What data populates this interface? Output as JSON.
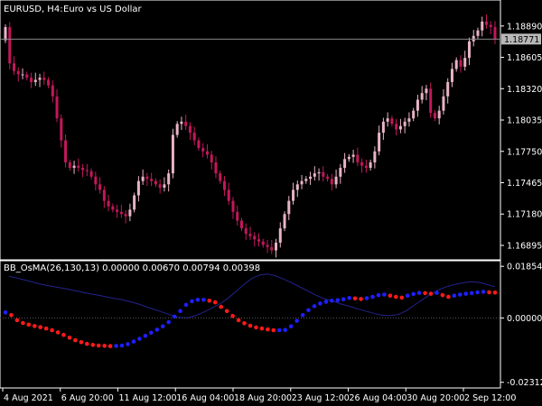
{
  "chart_header": {
    "symbol": "EURUSD, H4:",
    "description": "Euro vs US Dollar"
  },
  "current_price": "1.18771",
  "indicator_header": {
    "label": "BB_OsMA(26,130,13) 0.00000 0.00670 0.00794 0.00398"
  },
  "colors": {
    "background": "#000000",
    "candle": "#c2185b",
    "candle_light": "#e8b4c4",
    "osma_up": "#1f1fff",
    "osma_down": "#ff1a1a",
    "band": "#23238f",
    "axis": "#ffffff"
  },
  "chart_data": [
    {
      "type": "candlestick",
      "y_tick_labels": [
        "1.18890",
        "1.18605",
        "1.18320",
        "1.18035",
        "1.17750",
        "1.17465",
        "1.17180",
        "1.16895"
      ],
      "ylim": [
        1.1678,
        1.1911
      ],
      "x_tick_labels": [
        "4 Aug 2021",
        "6 Aug 20:00",
        "11 Aug 12:00",
        "16 Aug 04:00",
        "18 Aug 20:00",
        "23 Aug 12:00",
        "26 Aug 04:00",
        "30 Aug 20:00",
        "2 Sep 12:00"
      ],
      "close": [
        1.1888,
        1.1855,
        1.1848,
        1.1845,
        1.1845,
        1.1842,
        1.1838,
        1.184,
        1.1842,
        1.184,
        1.1835,
        1.1825,
        1.1805,
        1.1785,
        1.1765,
        1.176,
        1.1762,
        1.176,
        1.1758,
        1.1757,
        1.1752,
        1.1745,
        1.174,
        1.173,
        1.1725,
        1.1722,
        1.172,
        1.1718,
        1.1716,
        1.1722,
        1.1735,
        1.1748,
        1.1752,
        1.175,
        1.1748,
        1.1745,
        1.1742,
        1.1745,
        1.1755,
        1.179,
        1.18,
        1.1802,
        1.1798,
        1.1792,
        1.1785,
        1.1778,
        1.1775,
        1.1772,
        1.1765,
        1.1755,
        1.1748,
        1.174,
        1.173,
        1.172,
        1.1712,
        1.1705,
        1.17,
        1.1698,
        1.1695,
        1.1693,
        1.169,
        1.1688,
        1.1685,
        1.1692,
        1.1705,
        1.1718,
        1.173,
        1.174,
        1.1745,
        1.1748,
        1.175,
        1.1752,
        1.1755,
        1.1756,
        1.1752,
        1.175,
        1.1745,
        1.1752,
        1.176,
        1.1768,
        1.177,
        1.1772,
        1.1765,
        1.1762,
        1.176,
        1.1765,
        1.1775,
        1.1792,
        1.1802,
        1.1805,
        1.18,
        1.1795,
        1.1798,
        1.1802,
        1.1805,
        1.1812,
        1.1822,
        1.1828,
        1.1832,
        1.181,
        1.1805,
        1.1812,
        1.1825,
        1.1838,
        1.185,
        1.1858,
        1.1852,
        1.186,
        1.1875,
        1.188,
        1.1885,
        1.1893,
        1.189,
        1.1888,
        1.1877
      ]
    },
    {
      "type": "line",
      "y_tick_labels": [
        "0.01854",
        "0.00000",
        "-0.02312"
      ],
      "ylim": [
        -0.0245,
        0.0199
      ],
      "series": [
        {
          "values": [
            0.00198,
            0.001,
            -0.0008,
            -0.0018,
            -0.0024,
            -0.0029,
            -0.0033,
            -0.0038,
            -0.0044,
            -0.0052,
            -0.0061,
            -0.0071,
            -0.008,
            -0.0087,
            -0.0093,
            -0.0097,
            -0.0099,
            -0.01,
            -0.0101,
            -0.01005,
            -0.0099,
            -0.0094,
            -0.0085,
            -0.0075,
            -0.0064,
            -0.0053,
            -0.0042,
            -0.003,
            -0.0015,
            0.0005,
            0.0025,
            0.0047,
            0.006,
            0.0065,
            0.0065,
            0.0062,
            0.0056,
            0.004,
            0.0025,
            0.0007,
            -0.0008,
            -0.0019,
            -0.0028,
            -0.0034,
            -0.0038,
            -0.0041,
            -0.0044,
            -0.0044,
            -0.0043,
            -0.003,
            -0.001,
            0.001,
            0.0028,
            0.0042,
            0.0052,
            0.0058,
            0.0062,
            0.0064,
            0.0067,
            0.0072,
            0.007,
            0.0068,
            0.0071,
            0.0076,
            0.0082,
            0.0084,
            0.008,
            0.0076,
            0.0073,
            0.008,
            0.0086,
            0.009,
            0.0089,
            0.0087,
            0.009,
            0.0082,
            0.0076,
            0.008,
            0.0084,
            0.0087,
            0.0089,
            0.0092,
            0.0094,
            0.0092,
            0.0091
          ]
        },
        {
          "values": [
            0.015,
            0.0143,
            0.0136,
            0.0128,
            0.0121,
            0.0115,
            0.011,
            0.0105,
            0.0099,
            0.0093,
            0.0087,
            0.0082,
            0.0076,
            0.007,
            0.0065,
            0.0058,
            0.005,
            0.004,
            0.003,
            0.002,
            0.001,
            0.0002,
            0.0,
            0.0008,
            0.002,
            0.0035,
            0.005,
            0.007,
            0.0095,
            0.012,
            0.0142,
            0.0155,
            0.0158,
            0.015,
            0.0138,
            0.0125,
            0.011,
            0.0095,
            0.008,
            0.0068,
            0.006,
            0.005,
            0.0042,
            0.0033,
            0.0025,
            0.0017,
            0.001,
            0.0008,
            0.0012,
            0.0025,
            0.0045,
            0.0065,
            0.0085,
            0.01,
            0.0112,
            0.012,
            0.0126,
            0.013,
            0.0128,
            0.012,
            0.0112
          ]
        }
      ]
    }
  ]
}
